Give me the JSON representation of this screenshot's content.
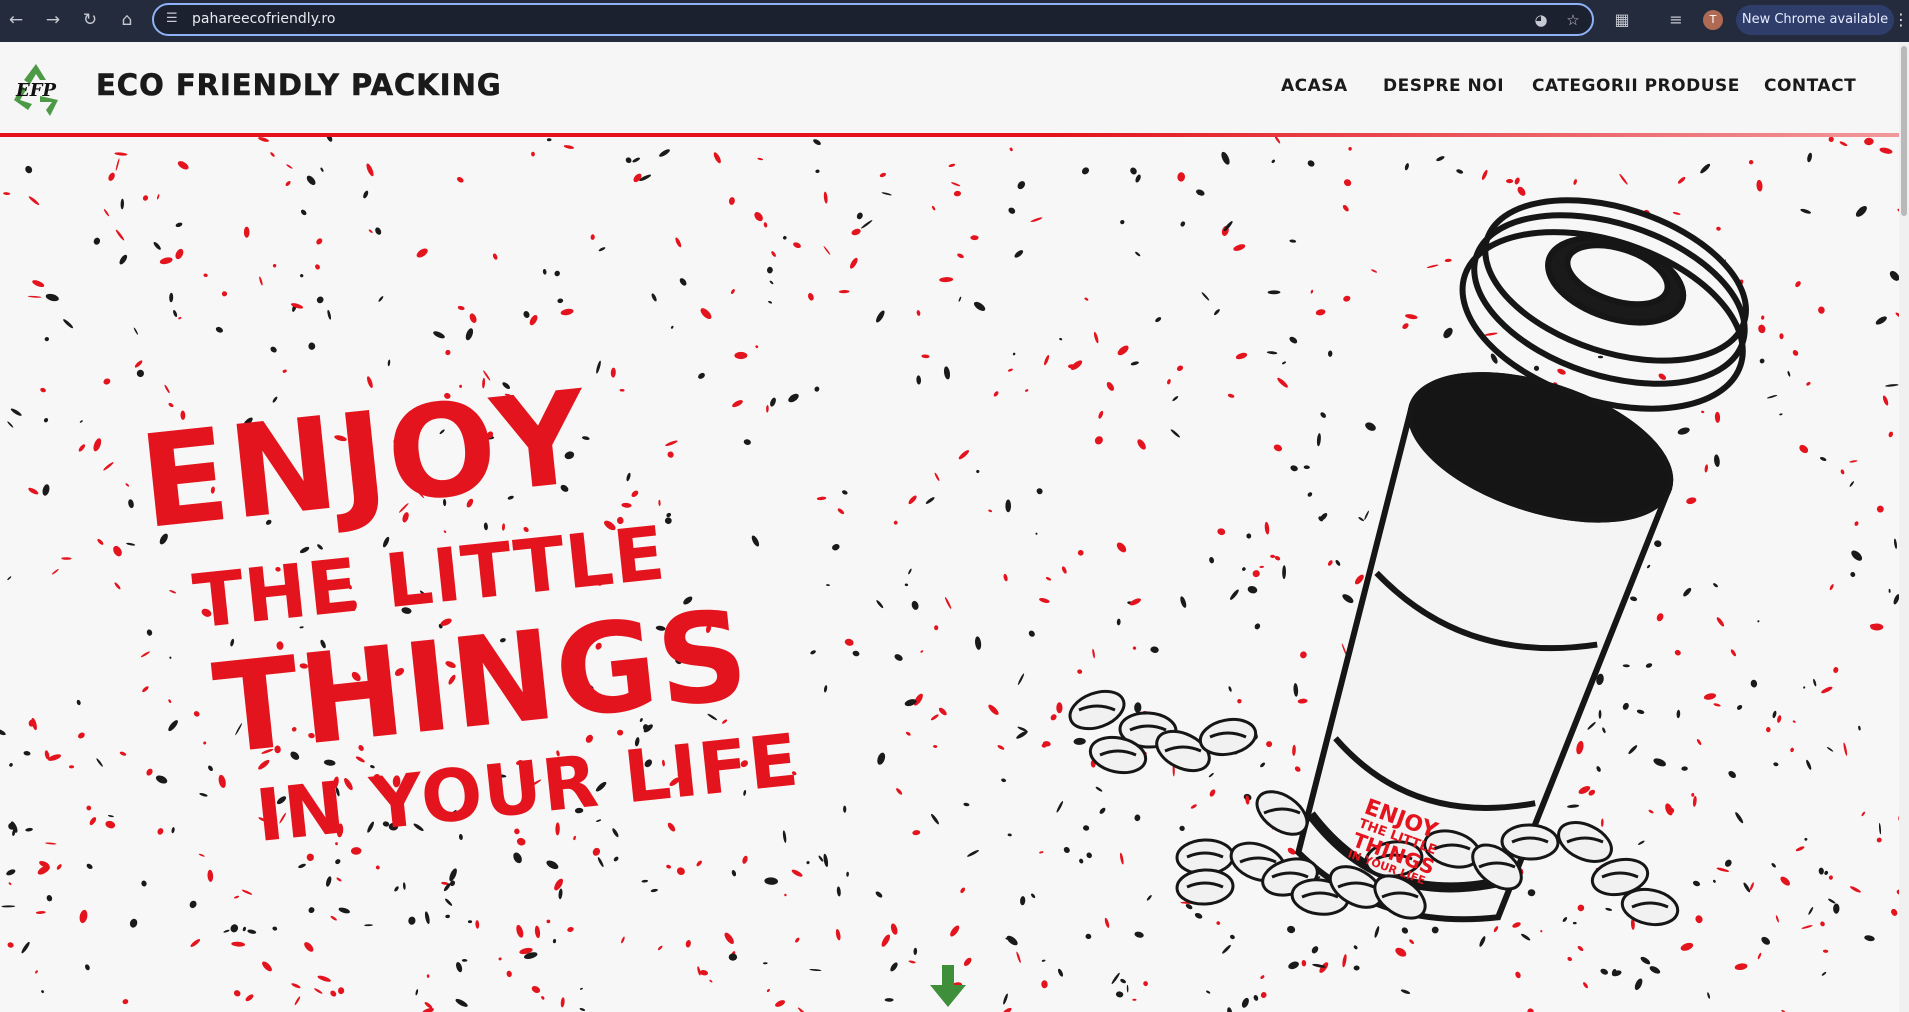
{
  "browser": {
    "url": "pahareecofriendly.ro",
    "avatar_initial": "T",
    "update_label": "New Chrome available",
    "icons": [
      "back-icon",
      "forward-icon",
      "reload-icon",
      "home-icon",
      "site-info-icon",
      "performance-icon",
      "bookmark-star-icon",
      "extensions-icon",
      "reading-list-icon",
      "profile-avatar",
      "menu-icon"
    ]
  },
  "site": {
    "title": "ECO FRIENDLY PACKING",
    "logo_text": "EFP",
    "nav": [
      "ACASA",
      "DESPRE NOI",
      "CATEGORII PRODUSE",
      "CONTACT"
    ]
  },
  "hero": {
    "lines": [
      "ENJOY",
      "THE LITTLE",
      "THINGS",
      "IN YOUR LIFE"
    ],
    "cup_label": [
      "ENJOY",
      "THE LITTLE",
      "THINGS",
      "IN YOUR LIFE"
    ]
  },
  "colors": {
    "brand_red": "#e3141d",
    "ink": "#1a1a1a",
    "recycle_green": "#4c9a45",
    "chrome_bg": "#242b3d"
  }
}
